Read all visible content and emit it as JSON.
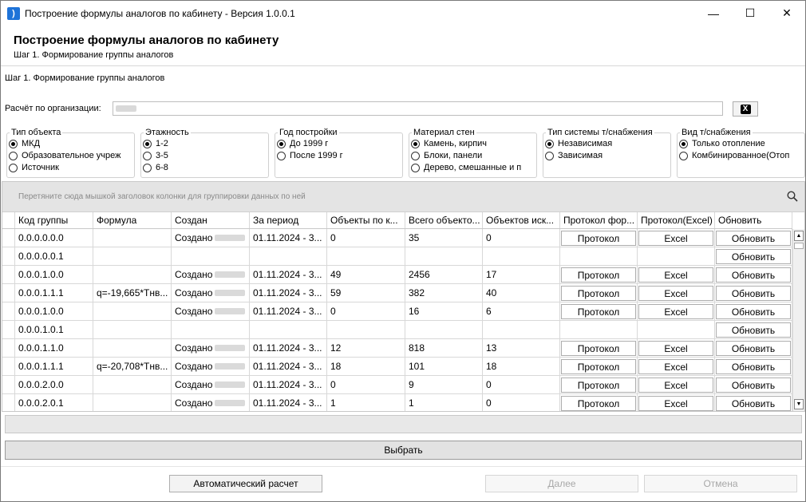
{
  "window": {
    "title": "Построение формулы аналогов по кабинету - Версия 1.0.0.1",
    "min_glyph": "—",
    "max_glyph": "☐",
    "close_glyph": "✕"
  },
  "header": {
    "title": "Построение формулы аналогов по кабинету",
    "subtitle": "Шаг 1. Формирование группы аналогов"
  },
  "step_label": "Шаг 1. Формирование группы аналогов",
  "org": {
    "label": "Расчёт по организации:",
    "clear_label": "X"
  },
  "filters": [
    {
      "title": "Тип объекта",
      "options": [
        {
          "label": "МКД",
          "checked": true
        },
        {
          "label": "Образовательное учреж",
          "checked": false
        },
        {
          "label": "Источник",
          "checked": false
        }
      ]
    },
    {
      "title": "Этажность",
      "options": [
        {
          "label": "1-2",
          "checked": true
        },
        {
          "label": "3-5",
          "checked": false
        },
        {
          "label": "6-8",
          "checked": false
        }
      ]
    },
    {
      "title": "Год постройки",
      "options": [
        {
          "label": "До 1999 г",
          "checked": true
        },
        {
          "label": "После 1999 г",
          "checked": false
        }
      ]
    },
    {
      "title": "Материал стен",
      "options": [
        {
          "label": "Камень, кирпич",
          "checked": true
        },
        {
          "label": "Блоки, панели",
          "checked": false
        },
        {
          "label": "Дерево, смешанные и п",
          "checked": false
        }
      ]
    },
    {
      "title": "Тип системы т/снабжения",
      "options": [
        {
          "label": "Независимая",
          "checked": true
        },
        {
          "label": "Зависимая",
          "checked": false
        }
      ]
    },
    {
      "title": "Вид т/снабжения",
      "options": [
        {
          "label": "Только отопление",
          "checked": true
        },
        {
          "label": "Комбинированное(Отоп",
          "checked": false
        }
      ]
    }
  ],
  "grid": {
    "group_hint": "Перетяните сюда мышкой заголовок колонки для группировки данных по ней",
    "columns": [
      "Код группы",
      "Формула",
      "Создан",
      "За период",
      "Объекты по к...",
      "Всего объекто...",
      "Объектов иск...",
      "Протокол фор...",
      "Протокол(Excel)",
      "Обновить"
    ],
    "rows": [
      {
        "code": "0.0.0.0.0.0",
        "formula": "",
        "created": "Создано",
        "period": "01.11.2024 - 3...",
        "obj_k": "0",
        "total": "35",
        "excluded": "0",
        "protocol": "Протокол",
        "excel": "Excel",
        "refresh": "Обновить"
      },
      {
        "code": "0.0.0.0.0.1",
        "formula": "",
        "created": "",
        "period": "",
        "obj_k": "",
        "total": "",
        "excluded": "",
        "protocol": "",
        "excel": "",
        "refresh": "Обновить"
      },
      {
        "code": "0.0.0.1.0.0",
        "formula": "",
        "created": "Создано",
        "period": "01.11.2024 - 3...",
        "obj_k": "49",
        "total": "2456",
        "excluded": "17",
        "protocol": "Протокол",
        "excel": "Excel",
        "refresh": "Обновить"
      },
      {
        "code": "0.0.0.1.1.1",
        "formula": "q=-19,665*Tнв...",
        "created": "Создано",
        "period": "01.11.2024 - 3...",
        "obj_k": "59",
        "total": "382",
        "excluded": "40",
        "protocol": "Протокол",
        "excel": "Excel",
        "refresh": "Обновить"
      },
      {
        "code": "0.0.0.1.0.0",
        "formula": "",
        "created": "Создано",
        "period": "01.11.2024 - 3...",
        "obj_k": "0",
        "total": "16",
        "excluded": "6",
        "protocol": "Протокол",
        "excel": "Excel",
        "refresh": "Обновить"
      },
      {
        "code": "0.0.0.1.0.1",
        "formula": "",
        "created": "",
        "period": "",
        "obj_k": "",
        "total": "",
        "excluded": "",
        "protocol": "",
        "excel": "",
        "refresh": "Обновить"
      },
      {
        "code": "0.0.0.1.1.0",
        "formula": "",
        "created": "Создано",
        "period": "01.11.2024 - 3...",
        "obj_k": "12",
        "total": "818",
        "excluded": "13",
        "protocol": "Протокол",
        "excel": "Excel",
        "refresh": "Обновить"
      },
      {
        "code": "0.0.0.1.1.1",
        "formula": "q=-20,708*Tнв...",
        "created": "Создано",
        "period": "01.11.2024 - 3...",
        "obj_k": "18",
        "total": "101",
        "excluded": "18",
        "protocol": "Протокол",
        "excel": "Excel",
        "refresh": "Обновить"
      },
      {
        "code": "0.0.0.2.0.0",
        "formula": "",
        "created": "Создано",
        "period": "01.11.2024 - 3...",
        "obj_k": "0",
        "total": "9",
        "excluded": "0",
        "protocol": "Протокол",
        "excel": "Excel",
        "refresh": "Обновить"
      },
      {
        "code": "0.0.0.2.0.1",
        "formula": "",
        "created": "Создано",
        "period": "01.11.2024 - 3...",
        "obj_k": "1",
        "total": "1",
        "excluded": "0",
        "protocol": "Протокол",
        "excel": "Excel",
        "refresh": "Обновить"
      }
    ]
  },
  "buttons": {
    "select": "Выбрать",
    "auto_calc": "Автоматический расчет",
    "next": "Далее",
    "cancel": "Отмена"
  }
}
